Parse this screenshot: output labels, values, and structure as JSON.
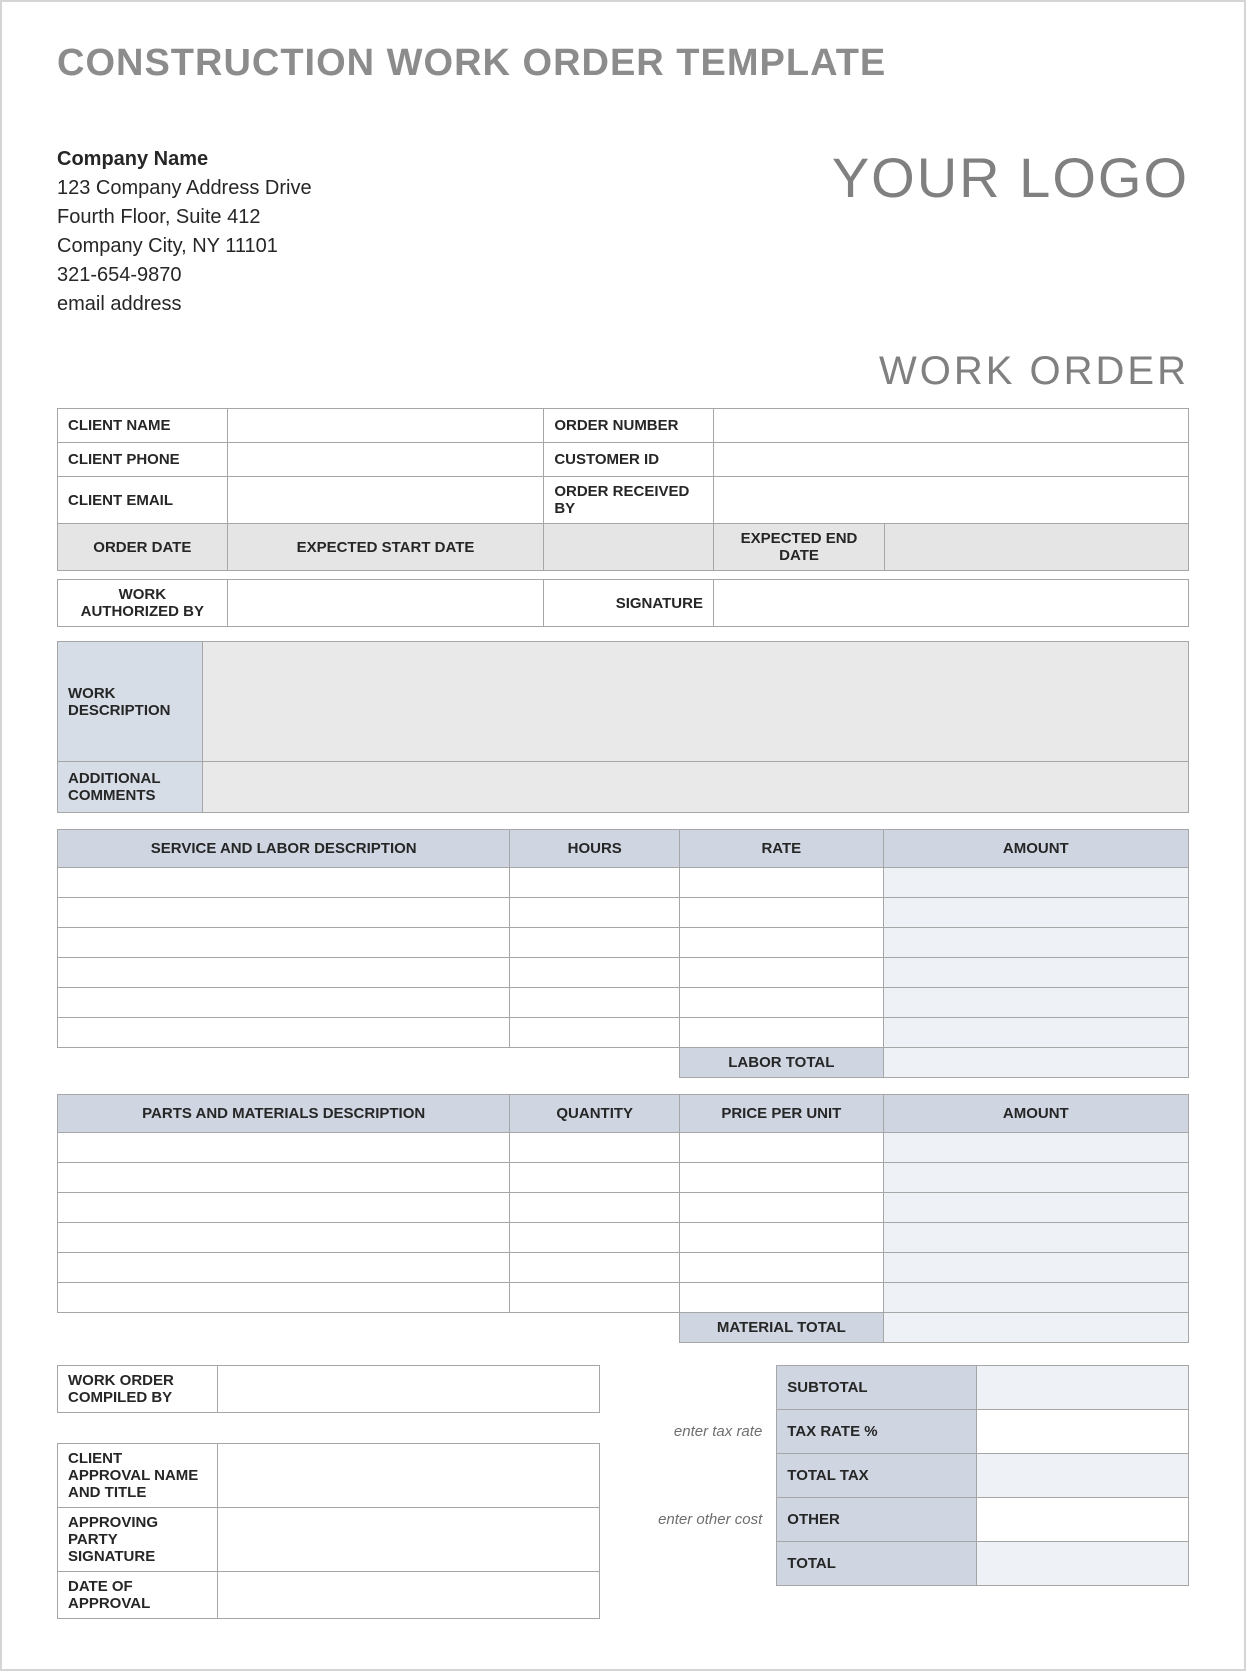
{
  "title": "CONSTRUCTION WORK ORDER TEMPLATE",
  "company": {
    "name": "Company Name",
    "addr1": "123 Company Address Drive",
    "addr2": "Fourth Floor, Suite 412",
    "city": "Company City, NY  11101",
    "phone": "321-654-9870",
    "email": "email address"
  },
  "logo": "YOUR LOGO",
  "heading": "WORK ORDER",
  "client": {
    "name_label": "CLIENT NAME",
    "name": "",
    "phone_label": "CLIENT PHONE",
    "phone": "",
    "email_label": "CLIENT EMAIL",
    "email": "",
    "order_number_label": "ORDER NUMBER",
    "order_number": "",
    "customer_id_label": "CUSTOMER ID",
    "customer_id": "",
    "received_by_label": "ORDER RECEIVED BY",
    "received_by": ""
  },
  "dates": {
    "order_date_label": "ORDER DATE",
    "order_date": "",
    "expected_start_label": "EXPECTED START DATE",
    "expected_start": "",
    "expected_end_label": "EXPECTED END DATE",
    "expected_end": ""
  },
  "auth": {
    "by_label": "WORK AUTHORIZED BY",
    "by": "",
    "sig_label": "SIGNATURE",
    "sig": ""
  },
  "desc": {
    "work_label": "WORK DESCRIPTION",
    "work": "",
    "comments_label": "ADDITIONAL COMMENTS",
    "comments": ""
  },
  "labor_headers": {
    "desc": "SERVICE AND LABOR DESCRIPTION",
    "hours": "HOURS",
    "rate": "RATE",
    "amount": "AMOUNT"
  },
  "labor_total_label": "LABOR TOTAL",
  "materials_headers": {
    "desc": "PARTS AND MATERIALS DESCRIPTION",
    "qty": "QUANTITY",
    "price": "PRICE PER UNIT",
    "amount": "AMOUNT"
  },
  "material_total_label": "MATERIAL TOTAL",
  "compiled": {
    "label": "WORK ORDER COMPILED BY",
    "value": ""
  },
  "approval": {
    "name_label": "CLIENT APPROVAL NAME AND TITLE",
    "name": "",
    "sig_label": "APPROVING PARTY SIGNATURE",
    "sig": "",
    "date_label": "DATE OF APPROVAL",
    "date": ""
  },
  "totals": {
    "subtotal_label": "SUBTOTAL",
    "subtotal": "",
    "tax_rate_label": "TAX RATE %",
    "tax_rate": "",
    "tax_rate_hint": "enter tax rate",
    "total_tax_label": "TOTAL TAX",
    "total_tax": "",
    "other_label": "OTHER",
    "other": "",
    "other_hint": "enter other cost",
    "total_label": "TOTAL",
    "total": ""
  }
}
